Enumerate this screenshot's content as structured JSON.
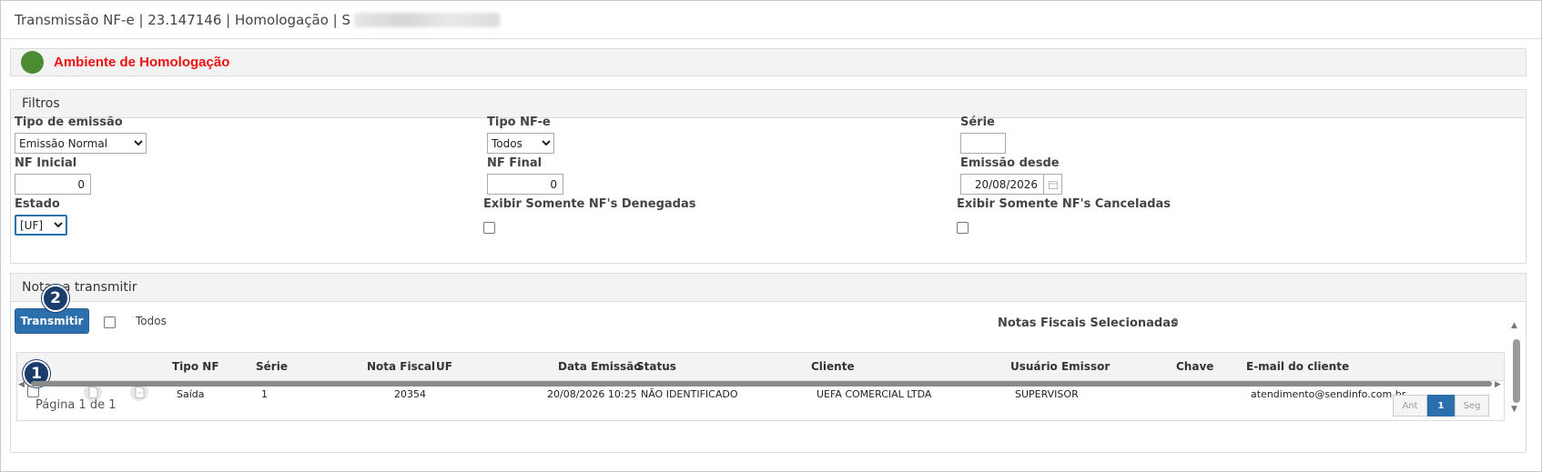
{
  "title": {
    "text": "Transmissão NF-e | 23.147146 | Homologação | S"
  },
  "environment": {
    "label": "Ambiente de Homologação",
    "status_color": "#4b8b32"
  },
  "filters": {
    "heading": "Filtros",
    "tipo_emissao": {
      "label": "Tipo de emissão",
      "value": "Emissão Normal"
    },
    "tipo_nfe": {
      "label": "Tipo NF-e",
      "value": "Todos"
    },
    "serie": {
      "label": "Série",
      "value": ""
    },
    "nf_inicial": {
      "label": "NF Inicial",
      "value": "0"
    },
    "nf_final": {
      "label": "NF Final",
      "value": "0"
    },
    "emissao_desde": {
      "label": "Emissão desde",
      "value": "20/08/2026"
    },
    "estado": {
      "label": "Estado",
      "value": "[UF]"
    },
    "somente_denegadas": {
      "label": "Exibir Somente NF's Denegadas",
      "checked": false
    },
    "somente_canceladas": {
      "label": "Exibir Somente NF's Canceladas",
      "checked": false
    }
  },
  "notes": {
    "heading": "Notas a transmitir",
    "transmit_button": "Transmitir",
    "select_all_label": "Todos",
    "selected_label": "Notas Fiscais Selecionadas",
    "selected_count": "0",
    "badge_1": "1",
    "badge_2": "2",
    "columns": {
      "tipo_nf": "Tipo NF",
      "serie": "Série",
      "nota_fiscal": "Nota Fiscal",
      "uf": "UF",
      "data_emissao": "Data Emissão",
      "status": "Status",
      "cliente": "Cliente",
      "usuario": "Usuário Emissor",
      "chave": "Chave",
      "email": "E-mail do cliente"
    },
    "rows": [
      {
        "tipo_nf": "Saída",
        "serie": "1",
        "nota_fiscal": "20354",
        "uf": "",
        "data_emissao": "20/08/2026 10:25",
        "status": "NÃO IDENTIFICADO",
        "cliente": "UEFA COMERCIAL LTDA",
        "usuario": "SUPERVISOR",
        "chave": "",
        "email": "atendimento@sendinfo.com.br"
      }
    ],
    "pagination": {
      "text": "Página 1 de 1",
      "prev": "Ant",
      "current": "1",
      "next": "Seg"
    }
  }
}
